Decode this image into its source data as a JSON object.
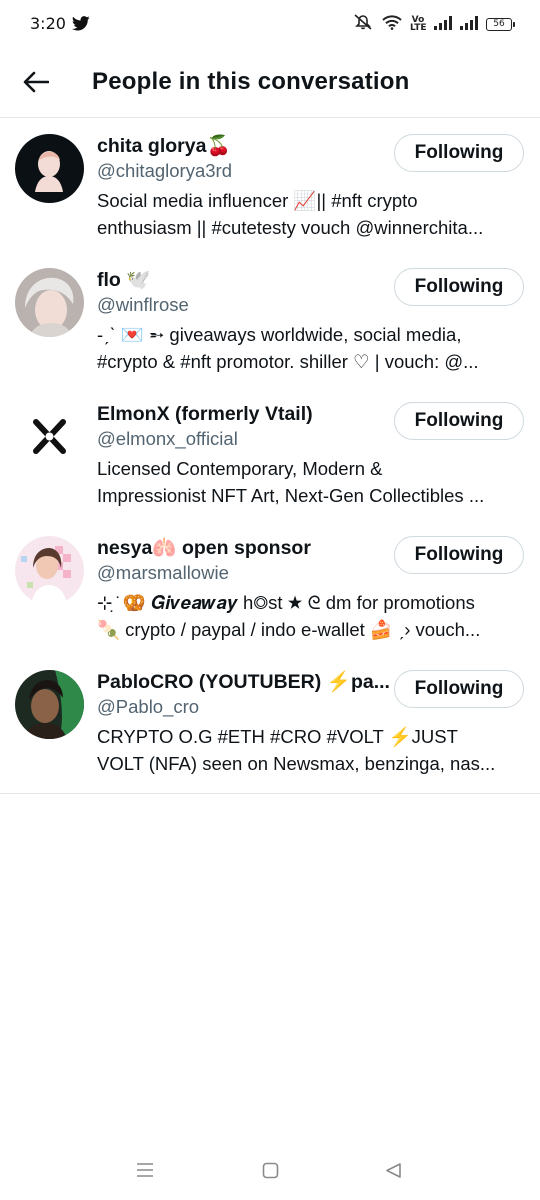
{
  "status_bar": {
    "time": "3:20",
    "volte": "Vo LTE",
    "battery": "56",
    "icons": [
      "twitter-bird-icon",
      "mute-icon",
      "wifi-icon",
      "signal-icon",
      "signal-icon",
      "battery-icon"
    ]
  },
  "header": {
    "title": "People in this conversation",
    "back_icon": "back-arrow-icon"
  },
  "people": [
    {
      "name": "chita glorya🍒",
      "handle": "@chitaglorya3rd",
      "bio_lines": [
        "Social media influencer 📈|| #nft crypto",
        "enthusiasm || #cutetesty vouch @winnerchita..."
      ],
      "button": "Following"
    },
    {
      "name": "flo 🕊️",
      "handle": "@winflrose",
      "bio_lines": [
        "-ˏˋ 💌 ➵ giveaways worldwide, social media,",
        "#crypto & #nft promotor. shiller ♡ | vouch: @..."
      ],
      "button": "Following"
    },
    {
      "name": "ElmonX (formerly Vtail)",
      "handle": "@elmonx_official",
      "bio_lines": [
        "Licensed Contemporary, Modern &",
        "Impressionist NFT Art, Next-Gen Collectibles ..."
      ],
      "button": "Following"
    },
    {
      "name": "nesya🫁 open sponsor",
      "handle": "@marsmallowie",
      "bio_lines": [
        "⊹ ̣̇ 🥨 𝑮𝒊𝒗𝒆𝒂𝒘𝒂𝒚 h◎st ★ ᘓ dm for promotions",
        "🍡 crypto / paypal / indo e-wallet 🍰 ˏ› vouch..."
      ],
      "button": "Following"
    },
    {
      "name": "PabloCRO (YOUTUBER) ⚡pa...",
      "handle": "@Pablo_cro",
      "bio_lines": [
        "CRYPTO O.G #ETH #CRO #VOLT ⚡JUST",
        "VOLT (NFA) seen on Newsmax, benzinga, nas..."
      ],
      "button": "Following"
    }
  ],
  "nav_bar": {
    "icons": [
      "menu-icon",
      "home-square-icon",
      "back-triangle-icon"
    ]
  },
  "colors": {
    "text": "#0f1419",
    "secondary": "#536471",
    "border": "#cfd9de",
    "divider": "#e6e9eb"
  }
}
